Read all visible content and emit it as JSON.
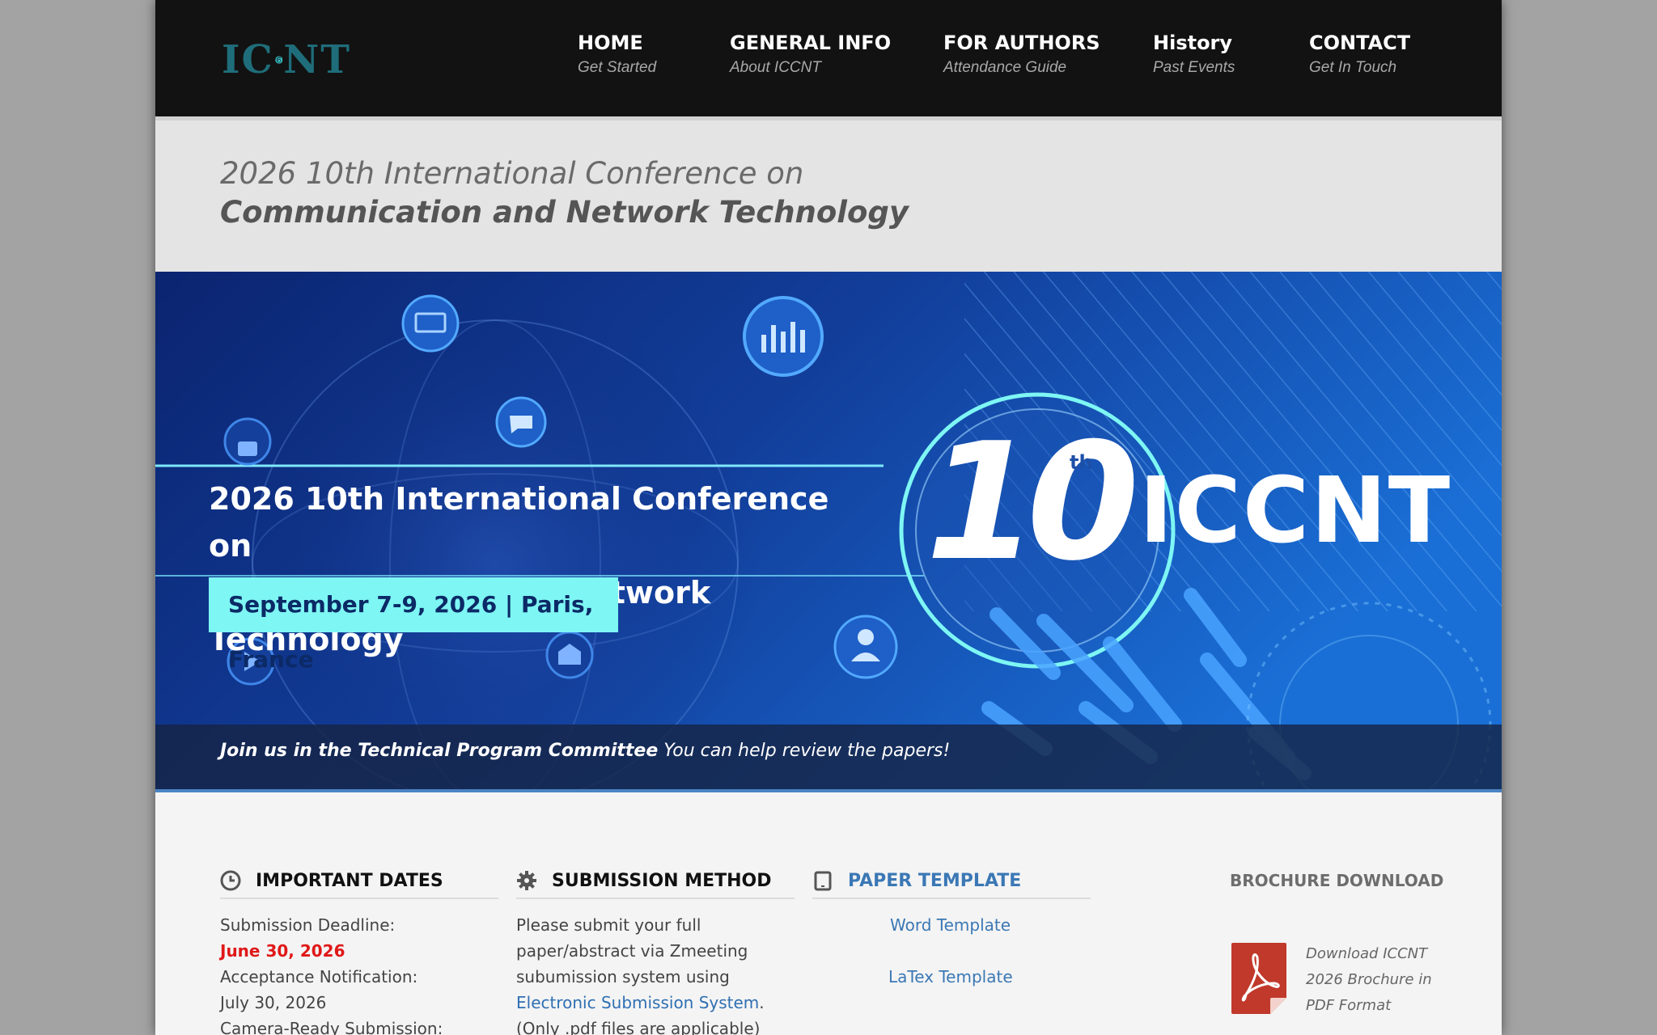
{
  "header": {
    "logo_text_left": "IC",
    "logo_text_right": "NT",
    "nav": [
      {
        "title": "HOME",
        "subtitle": "Get Started"
      },
      {
        "title": "GENERAL INFO",
        "subtitle": "About ICCNT"
      },
      {
        "title": "FOR AUTHORS",
        "subtitle": "Attendance Guide"
      },
      {
        "title": "History",
        "subtitle": "Past Events"
      },
      {
        "title": "CONTACT",
        "subtitle": "Get In Touch"
      }
    ]
  },
  "title_band": {
    "title_light": "2026 10th International Conference on ",
    "title_strong": "Communication and Network Technology"
  },
  "banner": {
    "conf_title_line1": "2026 10th International Conference on",
    "conf_title_line2": "Communication and Network Technology",
    "date_location": "September 7-9, 2026 | Paris, France",
    "edition_number": "10",
    "edition_suffix": "th",
    "acronym": "ICCNT",
    "caption_strong": "Join us in the Technical Program Committee",
    "caption_rest": " You can help review the papers!"
  },
  "important_dates": {
    "heading": "IMPORTANT DATES",
    "submission_label": "Submission Deadline:",
    "submission_value": "June 30, 2026",
    "acceptance_label": "Acceptance Notification:",
    "acceptance_value": "July 30, 2026",
    "camera_label": "Camera-Ready Submission:"
  },
  "submission_method": {
    "heading": "SUBMISSION METHOD",
    "line1": "Please submit your full",
    "line2": "paper/abstract via Zmeeting",
    "line3": "subumission system using",
    "link": "Electronic Submission System",
    "link_after": ".",
    "line5": "(Only .pdf files are applicable)"
  },
  "paper_template": {
    "heading": "PAPER TEMPLATE",
    "word": "Word Template",
    "latex": "LaTex Template"
  },
  "brochure": {
    "heading": "BROCHURE DOWNLOAD",
    "line1": "Download ICCNT",
    "line2": "2026 Brochure in",
    "line3": "PDF Format"
  },
  "colors": {
    "header_bg": "#121212",
    "accent_blue": "#2f6fb3",
    "deadline_red": "#e01818",
    "banner_cyan": "#7ef6f4"
  }
}
